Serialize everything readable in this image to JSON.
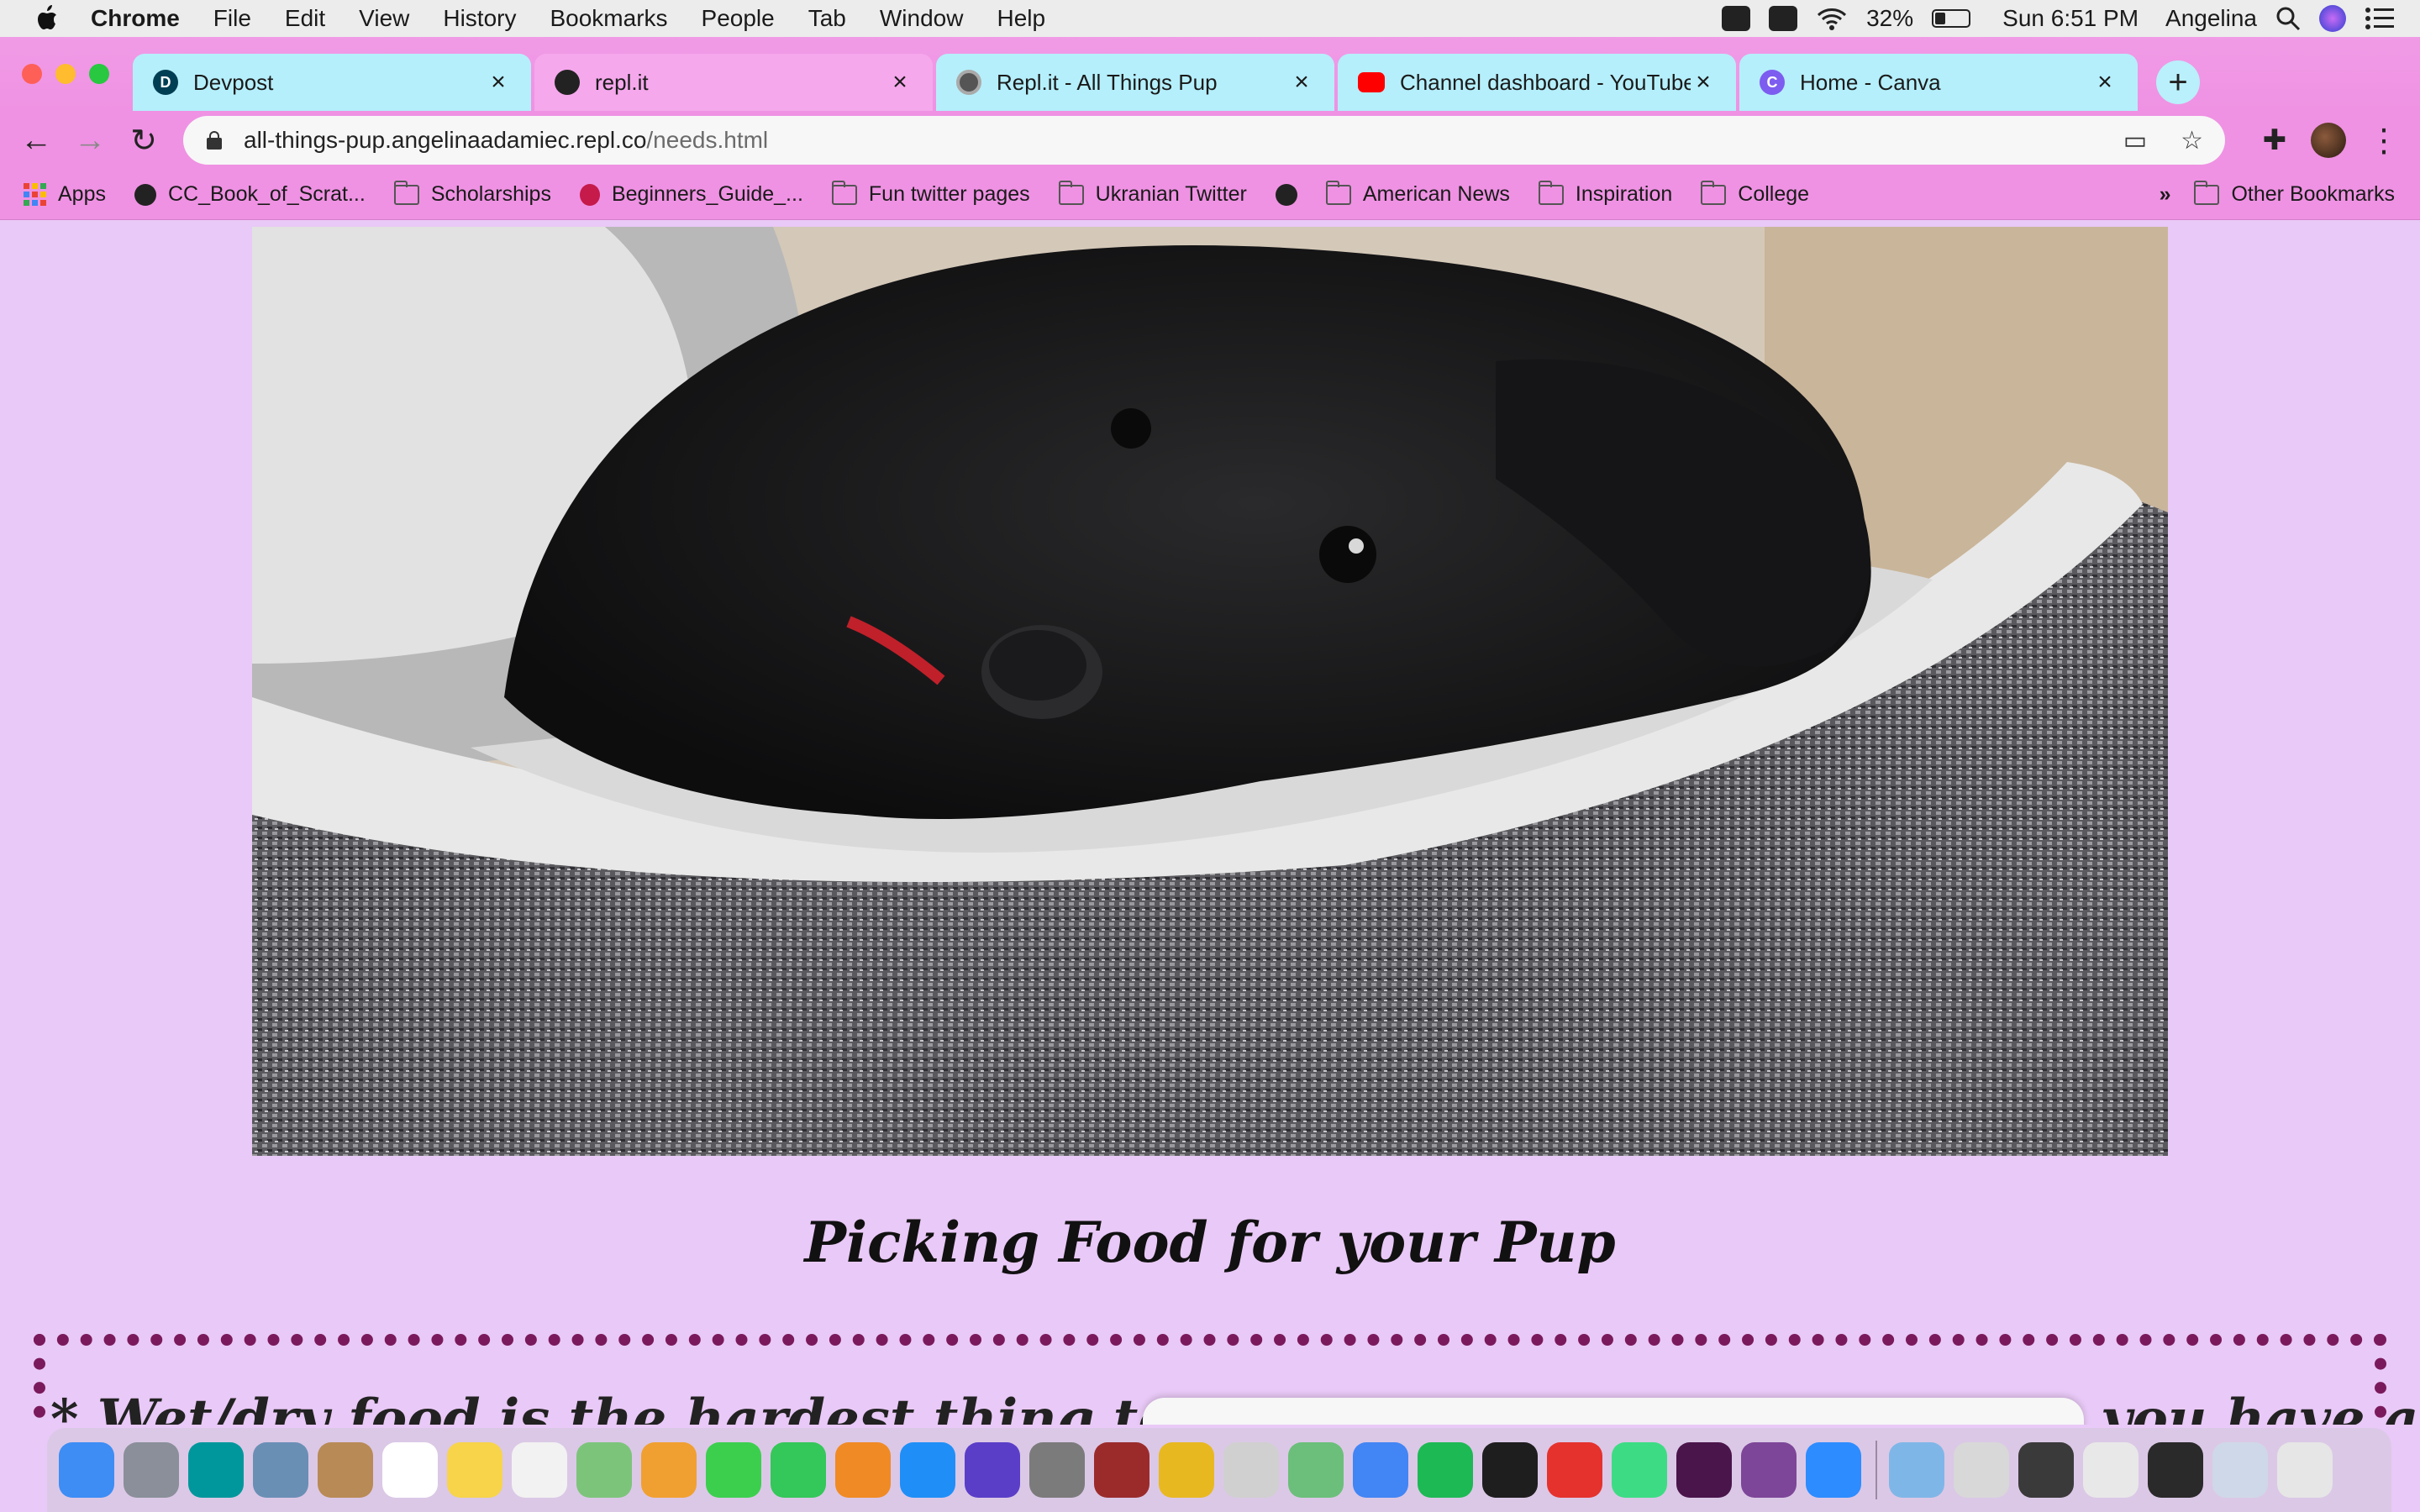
{
  "menubar": {
    "app": "Chrome",
    "items": [
      "File",
      "Edit",
      "View",
      "History",
      "Bookmarks",
      "People",
      "Tab",
      "Window",
      "Help"
    ],
    "battery": "32%",
    "clock": "Sun 6:51 PM",
    "user": "Angelina"
  },
  "tabs": [
    {
      "label": "Devpost",
      "favicon": "D",
      "color": "#b5effb",
      "favicon_color": "#003e54"
    },
    {
      "label": "repl.it",
      "favicon": "",
      "color": "#f5a8ec",
      "favicon_color": "#222222"
    },
    {
      "label": "Repl.it - All Things Pup",
      "favicon": "",
      "color": "#b5effb",
      "favicon_color": "#555555"
    },
    {
      "label": "Channel dashboard - YouTube",
      "favicon": "",
      "color": "#b5effb",
      "favicon_color": "#ff0000"
    },
    {
      "label": "Home - Canva",
      "favicon": "C",
      "color": "#b5effb",
      "favicon_color": "#7d5cf0"
    }
  ],
  "tab_close": "×",
  "new_tab": "+",
  "toolbar": {
    "back": "←",
    "forward": "→",
    "reload": "↻",
    "url_host": "all-things-pup.angelinaadamiec.repl.co",
    "url_path": "/needs.html",
    "cast_icon": "▭",
    "star_icon": "☆",
    "extensions_icon": "✚",
    "menu_icon": "⋮"
  },
  "bookmarks": [
    {
      "label": "Apps",
      "icon": "apps-grid"
    },
    {
      "label": "CC_Book_of_Scrat...",
      "icon": "globe"
    },
    {
      "label": "Scholarships",
      "icon": "folder"
    },
    {
      "label": "Beginners_Guide_...",
      "icon": "raspberry"
    },
    {
      "label": "Fun twitter pages",
      "icon": "folder"
    },
    {
      "label": "Ukranian Twitter",
      "icon": "folder"
    },
    {
      "label": "",
      "icon": "globe"
    },
    {
      "label": "American News",
      "icon": "folder"
    },
    {
      "label": "Inspiration",
      "icon": "folder"
    },
    {
      "label": "College",
      "icon": "folder"
    }
  ],
  "bookmarks_overflow": "»",
  "other_bookmarks": "Other Bookmarks",
  "page": {
    "headline": "Picking Food for your Pup",
    "body_start": "* Wet/dry food is the hardest thing to get ar",
    "body_end": "you have a"
  },
  "colors": {
    "page_bg": "#e9c9f7",
    "dotted_border": "#7a1a5c",
    "chrome_pink": "#ef92e3",
    "tab_cyan": "#b5effb"
  },
  "dock": [
    {
      "name": "finder",
      "color": "#3d8df5"
    },
    {
      "name": "launchpad",
      "color": "#8a8f99"
    },
    {
      "name": "arduino",
      "color": "#00979c"
    },
    {
      "name": "preview",
      "color": "#6a8fb5"
    },
    {
      "name": "contacts",
      "color": "#b88a55"
    },
    {
      "name": "calendar",
      "color": "#ffffff"
    },
    {
      "name": "notes",
      "color": "#f7d44a"
    },
    {
      "name": "reminders",
      "color": "#f2f2f2"
    },
    {
      "name": "maps",
      "color": "#7cc47a"
    },
    {
      "name": "photos",
      "color": "#f0a030"
    },
    {
      "name": "messages",
      "color": "#3ccf4e"
    },
    {
      "name": "facetime",
      "color": "#34c759"
    },
    {
      "name": "books",
      "color": "#f08a24"
    },
    {
      "name": "app-store",
      "color": "#1f8ff7"
    },
    {
      "name": "siri",
      "color": "#5a3ec8"
    },
    {
      "name": "system-preferences",
      "color": "#7b7b7b"
    },
    {
      "name": "dictionary",
      "color": "#9b2b2b"
    },
    {
      "name": "chrome-canary",
      "color": "#e8b820"
    },
    {
      "name": "help",
      "color": "#d0d0d0"
    },
    {
      "name": "atom",
      "color": "#6bbf7a"
    },
    {
      "name": "chrome",
      "color": "#4285f4"
    },
    {
      "name": "spotify",
      "color": "#1db954"
    },
    {
      "name": "terminal",
      "color": "#1e1e1e"
    },
    {
      "name": "brave",
      "color": "#e5322d"
    },
    {
      "name": "android-studio",
      "color": "#3ddc84"
    },
    {
      "name": "slack",
      "color": "#4a154b"
    },
    {
      "name": "tor",
      "color": "#7d4698"
    },
    {
      "name": "zoom",
      "color": "#2d8cff"
    }
  ],
  "dock_right": [
    {
      "name": "downloads-folder",
      "color": "#7fb6e8"
    },
    {
      "name": "screenshot-1",
      "color": "#d8d8d8"
    },
    {
      "name": "screenshot-2",
      "color": "#3a3a3a"
    },
    {
      "name": "screenshot-3",
      "color": "#e8e8e8"
    },
    {
      "name": "screenshot-4",
      "color": "#2a2a2a"
    },
    {
      "name": "screenshot-5",
      "color": "#cfd8e8"
    },
    {
      "name": "trash",
      "color": "#e6e6e6"
    }
  ]
}
